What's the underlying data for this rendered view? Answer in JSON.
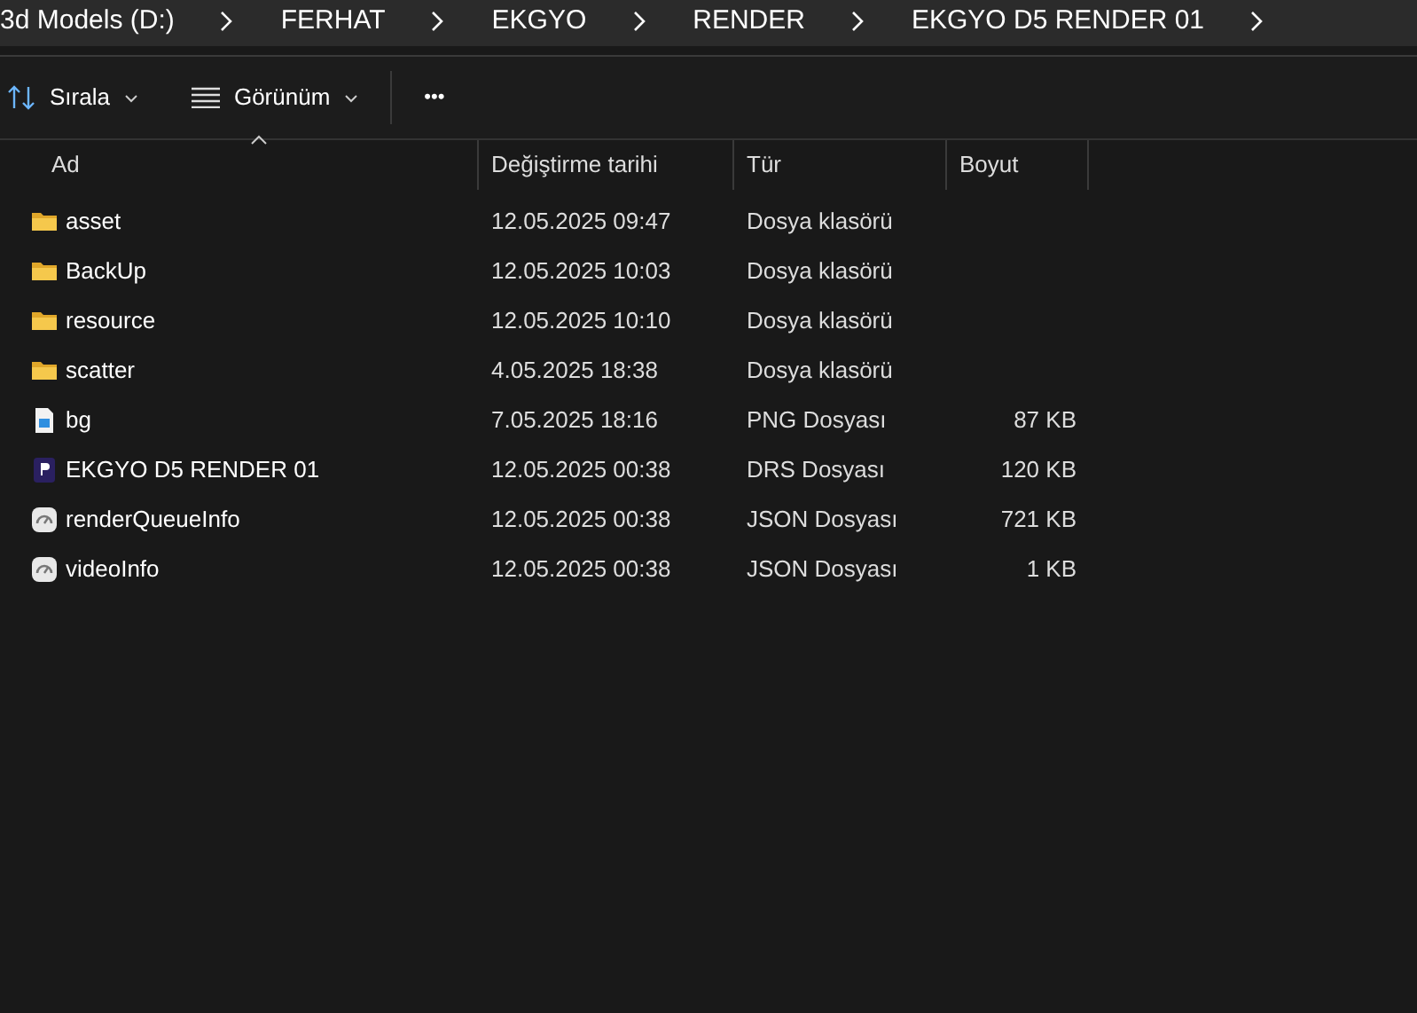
{
  "breadcrumb": [
    "3d Models (D:)",
    "FERHAT",
    "EKGYO",
    "RENDER",
    "EKGYO D5 RENDER 01"
  ],
  "toolbar": {
    "sort_label": "Sırala",
    "view_label": "Görünüm",
    "more": "•••"
  },
  "columns": [
    {
      "label": "Ad",
      "sorted": true
    },
    {
      "label": "Değiştirme tarihi",
      "sorted": false
    },
    {
      "label": "Tür",
      "sorted": false
    },
    {
      "label": "Boyut",
      "sorted": false
    }
  ],
  "files": [
    {
      "kind": "folder",
      "name": "asset",
      "date": "12.05.2025 09:47",
      "type": "Dosya klasörü"
    },
    {
      "kind": "folder",
      "name": "BackUp",
      "date": "12.05.2025 10:03",
      "type": "Dosya klasörü"
    },
    {
      "kind": "folder",
      "name": "resource",
      "date": "12.05.2025 10:10",
      "type": "Dosya klasörü"
    },
    {
      "kind": "folder",
      "name": "scatter",
      "date": "4.05.2025 18:38",
      "type": "Dosya klasörü"
    },
    {
      "kind": "image",
      "name": "bg",
      "date": "7.05.2025 18:16",
      "type": "PNG Dosyası",
      "size": "87 KB"
    },
    {
      "kind": "drs",
      "name": "EKGYO D5 RENDER 01",
      "date": "12.05.2025 00:38",
      "type": "DRS Dosyası",
      "size": "120 KB"
    },
    {
      "kind": "json",
      "name": "renderQueueInfo",
      "date": "12.05.2025 00:38",
      "type": "JSON Dosyası",
      "size": "721 KB"
    },
    {
      "kind": "json",
      "name": "videoInfo",
      "date": "12.05.2025 00:38",
      "type": "JSON Dosyası",
      "size": "1 KB"
    }
  ]
}
